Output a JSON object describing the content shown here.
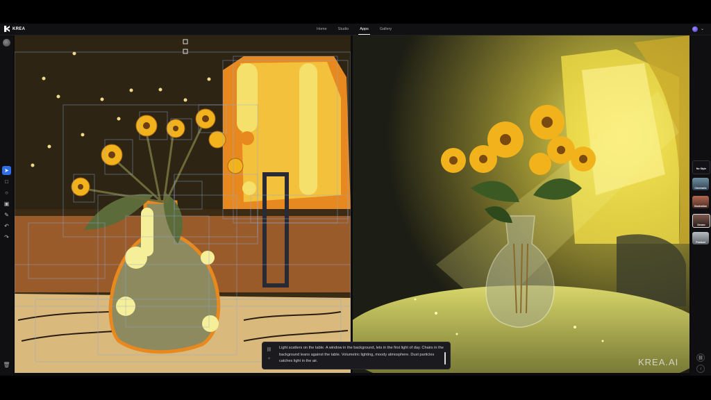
{
  "brand": {
    "name": "KREA"
  },
  "nav": {
    "links": [
      "Home",
      "Studio",
      "Apps",
      "Gallery"
    ],
    "active": "Apps"
  },
  "tools": [
    {
      "icon": "pointer-icon",
      "glyph": "➤"
    },
    {
      "icon": "square-icon",
      "glyph": "□"
    },
    {
      "icon": "circle-icon",
      "glyph": "○"
    },
    {
      "icon": "image-icon",
      "glyph": "▣"
    },
    {
      "icon": "pen-icon",
      "glyph": "✎"
    },
    {
      "icon": "undo-icon",
      "glyph": "↶"
    },
    {
      "icon": "redo-icon",
      "glyph": "↷"
    }
  ],
  "styles": [
    {
      "label": "No Style",
      "color": "#111116"
    },
    {
      "label": "Cinematic",
      "color": "#4e6a7c"
    },
    {
      "label": "Illustration",
      "color": "#7b4a3a"
    },
    {
      "label": "Dream",
      "color": "#5a3f3a"
    },
    {
      "label": "Product",
      "color": "#8a8f96"
    }
  ],
  "prompt": {
    "text": "Light scatters on the table. A window in the background, lets in the first light of day. Chairs in the background leans against the table. Volumetric lighting, moody atmosphere. Dust particles catches light in the air."
  },
  "watermark": "KREA.AI",
  "colors": {
    "accent": "#2f6fe6",
    "sunflower": "#f2b21c",
    "glow": "#f6ef5a"
  }
}
